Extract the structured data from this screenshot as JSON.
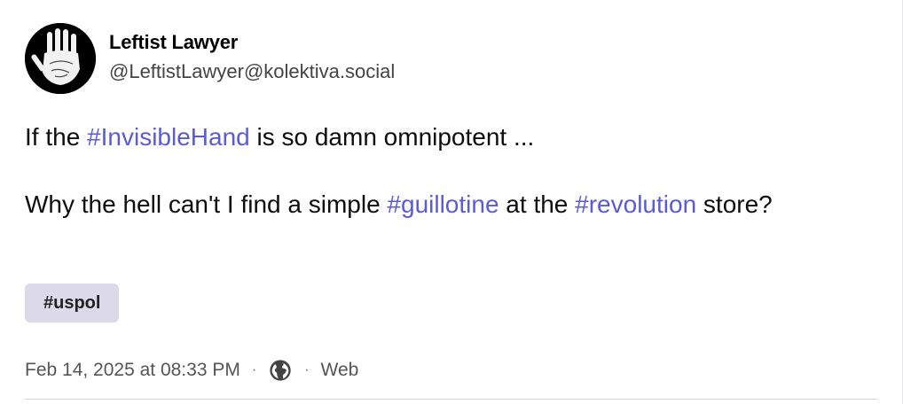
{
  "author": {
    "display_name": "Leftist Lawyer",
    "handle": "@LeftistLawyer@kolektiva.social",
    "avatar_icon": "hand-print-icon"
  },
  "post": {
    "line1": {
      "prefix": "If the ",
      "hashtag": "#InvisibleHand",
      "suffix": " is so damn omnipotent  ..."
    },
    "line2": {
      "prefix": "Why the hell can't I find a simple ",
      "hashtag1": "#guillotine",
      "middle": " at the ",
      "hashtag2": "#revolution",
      "suffix": " store?"
    }
  },
  "tags": [
    "#uspol"
  ],
  "meta": {
    "timestamp": "Feb 14, 2025 at 08:33 PM",
    "separator": "·",
    "visibility_icon": "globe-icon",
    "client": "Web"
  },
  "colors": {
    "hashtag": "#5b5bd6",
    "chip_bg": "#dcdae8"
  }
}
